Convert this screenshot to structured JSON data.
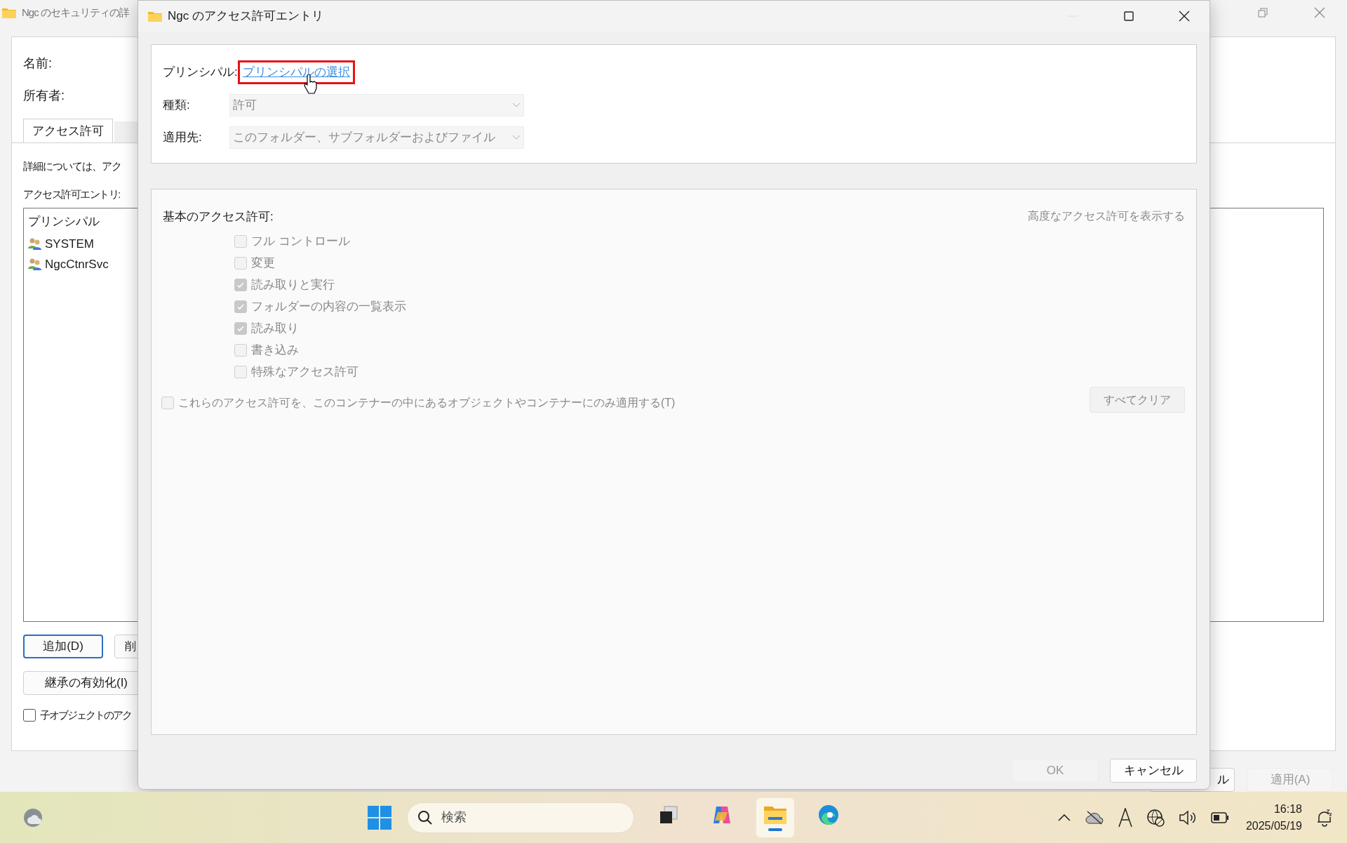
{
  "background_window": {
    "title": "Ngc のセキュリティの詳",
    "fields": [
      {
        "label": "名前:"
      },
      {
        "label": "所有者:"
      }
    ],
    "tabs": [
      {
        "label": "アクセス許可",
        "selected": true
      }
    ],
    "info_text": "詳細については、アク",
    "entries_label": "アクセス許可エントリ:",
    "list": {
      "header": "プリンシパル",
      "rows": [
        {
          "name": "SYSTEM"
        },
        {
          "name": "NgcCtnrSvc"
        }
      ]
    },
    "row_buttons": [
      {
        "label": "追加(D)",
        "focused": true
      },
      {
        "label": "削",
        "focused": false
      }
    ],
    "inherit_button": "継承の有効化(I)",
    "child_checkbox": {
      "label": "子オブジェクトのアク",
      "checked": false
    },
    "footer_buttons": [
      {
        "label": "ル",
        "disabled": false
      },
      {
        "label": "適用(A)",
        "disabled": true
      }
    ]
  },
  "dialog": {
    "title": "Ngc のアクセス許可エントリ",
    "principal": {
      "label": "プリンシパル:",
      "link": "プリンシパルの選択",
      "highlighted": true
    },
    "fields": [
      {
        "label": "種類:",
        "value": "許可",
        "disabled": true
      },
      {
        "label": "適用先:",
        "value": "このフォルダー、サブフォルダーおよびファイル",
        "disabled": true
      }
    ],
    "basic_permissions": {
      "title": "基本のアクセス許可:",
      "advanced_link": "高度なアクセス許可を表示する",
      "items": [
        {
          "label": "フル コントロール",
          "checked": false,
          "disabled": true
        },
        {
          "label": "変更",
          "checked": false,
          "disabled": true
        },
        {
          "label": "読み取りと実行",
          "checked": true,
          "disabled": true
        },
        {
          "label": "フォルダーの内容の一覧表示",
          "checked": true,
          "disabled": true
        },
        {
          "label": "読み取り",
          "checked": true,
          "disabled": true
        },
        {
          "label": "書き込み",
          "checked": false,
          "disabled": true
        },
        {
          "label": "特殊なアクセス許可",
          "checked": false,
          "disabled": true
        }
      ]
    },
    "apply_only": {
      "label": "これらのアクセス許可を、このコンテナーの中にあるオブジェクトやコンテナーにのみ適用する(T)",
      "checked": false,
      "disabled": true
    },
    "clear_all": {
      "label": "すべてクリア",
      "disabled": true
    },
    "buttons": [
      {
        "label": "OK",
        "disabled": true
      },
      {
        "label": "キャンセル",
        "disabled": false
      }
    ]
  },
  "taskbar": {
    "search": {
      "placeholder": "検索"
    },
    "apps": [
      {
        "kind": "taskview",
        "selected": false
      },
      {
        "kind": "copilot",
        "selected": false
      },
      {
        "kind": "explorer",
        "selected": true
      },
      {
        "kind": "edge",
        "selected": false
      }
    ],
    "clock": {
      "time": "16:18",
      "date": "2025/05/19"
    }
  }
}
